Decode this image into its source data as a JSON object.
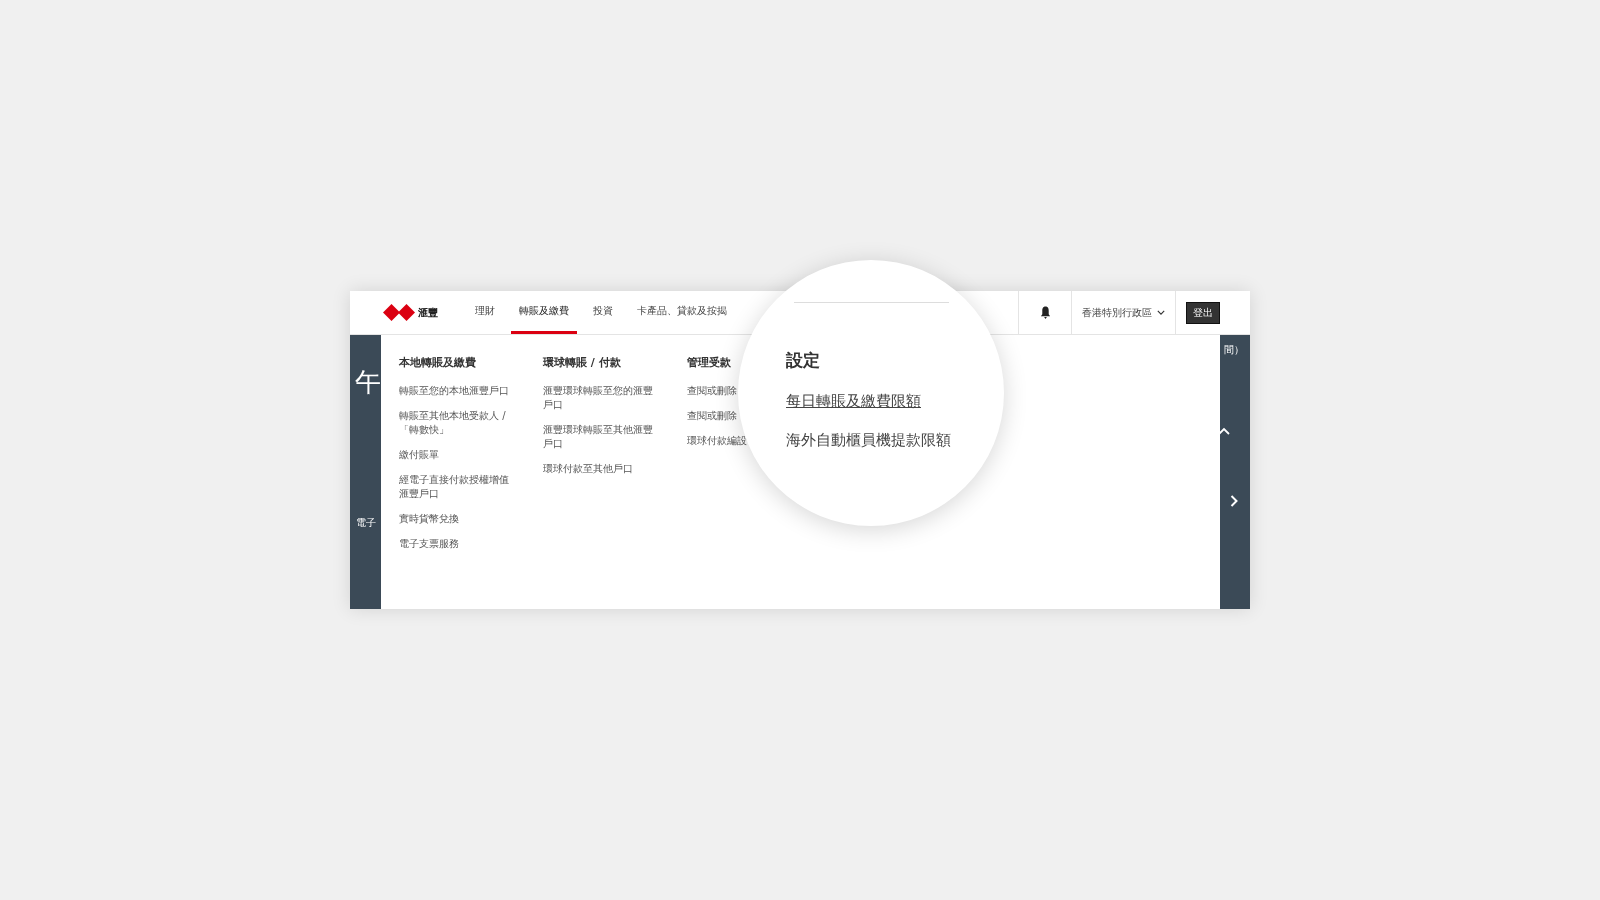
{
  "header": {
    "logo_text": "滙豐",
    "tabs": [
      {
        "label": "理財",
        "selected": false
      },
      {
        "label": "轉賬及繳費",
        "selected": true
      },
      {
        "label": "投資",
        "selected": false
      },
      {
        "label": "卡產品、貸款及按揭",
        "selected": false
      }
    ],
    "region": "香港特別行政區",
    "logout": "登出"
  },
  "background": {
    "left_texts": [
      "午",
      "電子"
    ],
    "right_text": "間）"
  },
  "menu": {
    "columns": [
      {
        "heading": "本地轉賬及繳費",
        "items": [
          "轉賬至您的本地滙豐戶口",
          "轉賬至其他本地受款人 / 「轉數快」",
          "繳付賬單",
          "經電子直接付款授權增值滙豐戶口",
          "實時貨幣兌換",
          "電子支票服務"
        ]
      },
      {
        "heading": "環球轉賬 / 付款",
        "items": [
          "滙豐環球轉賬至您的滙豐戶口",
          "滙豐環球轉賬至其他滙豐戶口",
          "環球付款至其他戶口"
        ]
      },
      {
        "heading": "管理受款",
        "items": [
          "查閱或刪除",
          "查閱或刪除",
          "環球付款編設"
        ]
      }
    ]
  },
  "magnifier": {
    "heading": "設定",
    "items": [
      {
        "label": "每日轉賬及繳費限額",
        "selected": true
      },
      {
        "label": "海外自動櫃員機提款限額",
        "selected": false
      }
    ]
  }
}
